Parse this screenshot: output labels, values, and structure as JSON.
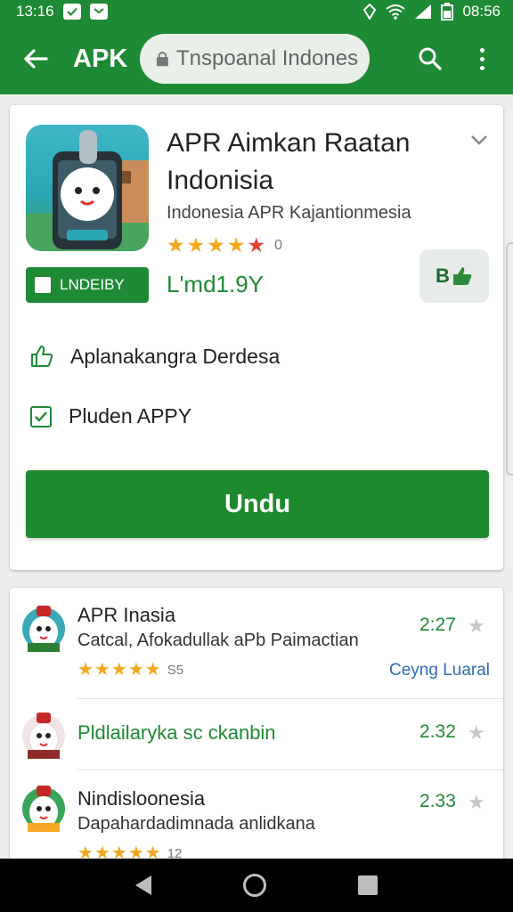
{
  "status_bar": {
    "time_left": "13:16",
    "time_right": "08:56"
  },
  "app_bar": {
    "title": "APK",
    "url": "Tnspoanal Indonesia"
  },
  "app": {
    "title_line1": "APR Aimkan Raatan",
    "title_line2": "Indonisia",
    "developer": "Indonesia APR Kajantionmesia",
    "rating_count": "0",
    "badge": "LNDEIBY",
    "price": "L'md1.9Y",
    "wish_label": "B"
  },
  "features": [
    {
      "label": "Aplanakangra Derdesa",
      "icon": "thumbs-up-icon"
    },
    {
      "label": "Pluden APPY",
      "icon": "check-box-icon"
    }
  ],
  "download_label": "Undu",
  "list": [
    {
      "title": "APR Inasia",
      "subtitle": "Catcal, Afokadullak aPb Paimactian",
      "rating_count": "S5",
      "price": "2:27",
      "link": "Ceyng Luaral"
    },
    {
      "title": "Pldlailaryka sc ckanbin",
      "price": "2.32"
    },
    {
      "title": "Nindisloonesia",
      "subtitle": "Dapahardadimnada anlidkana",
      "rating_count": "12",
      "price": "2.33"
    }
  ],
  "colors": {
    "primary": "#1f8a36",
    "star": "#f2a81d",
    "link": "#2e6db5"
  }
}
